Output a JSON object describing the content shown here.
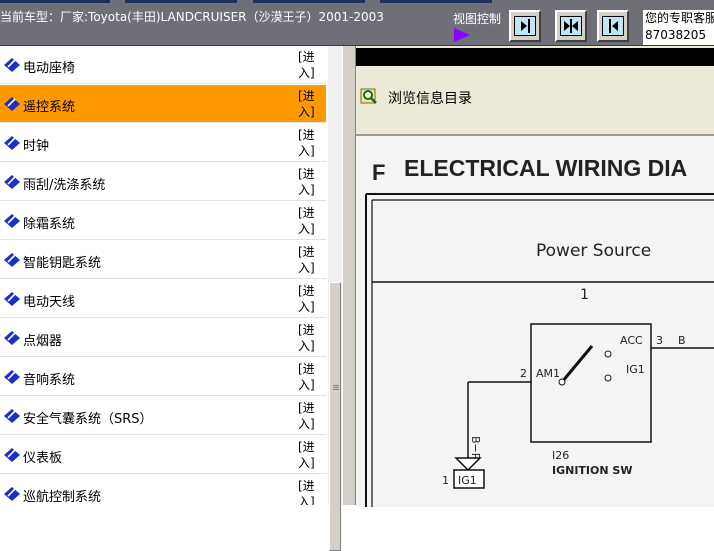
{
  "header": {
    "vehicle_label": "当前车型：厂家:Toyota(丰田)LANDCRUISER（沙漠王子）2001-2003",
    "view_control_label": "视图控制",
    "exclusive_label": "您的专职客服",
    "exclusive_number": "87038205",
    "view_buttons": [
      {
        "name": "expand-right-icon"
      },
      {
        "name": "split-view-icon"
      },
      {
        "name": "expand-left-icon"
      }
    ]
  },
  "menu": {
    "enter_label": "[进入]",
    "items": [
      {
        "label": "电动座椅",
        "active": false
      },
      {
        "label": "遥控系统",
        "active": true
      },
      {
        "label": "时钟",
        "active": false
      },
      {
        "label": "雨刮/洗涤系统",
        "active": false
      },
      {
        "label": "除霜系统",
        "active": false
      },
      {
        "label": "智能钥匙系统",
        "active": false
      },
      {
        "label": "电动天线",
        "active": false
      },
      {
        "label": "点烟器",
        "active": false
      },
      {
        "label": "音响系统",
        "active": false
      },
      {
        "label": "安全气囊系统（SRS）",
        "active": false
      },
      {
        "label": "仪表板",
        "active": false
      },
      {
        "label": "巡航控制系统",
        "active": false
      }
    ]
  },
  "viewer": {
    "browse_label": "浏览信息目录",
    "diagram": {
      "heading_letter": "F",
      "heading_text": "ELECTRICAL WIRING DIA",
      "section_title": "Power Source",
      "column_number": "1",
      "pin_2": "2",
      "pin_am1": "AM1",
      "pin_acc": "ACC",
      "pin_3": "3",
      "wire_b": "B",
      "pin_ig1": "IG1",
      "wire_br": "B−R",
      "connector_num": "1",
      "connector_ig1": "IG1",
      "component_code": "I26",
      "component_name": "IGNITION SW"
    }
  },
  "colors": {
    "topbar": "#6f6f77",
    "active_item": "#ff9900",
    "view_arrow": "#8b00ff",
    "icon_blue": "#1e2fc8"
  }
}
